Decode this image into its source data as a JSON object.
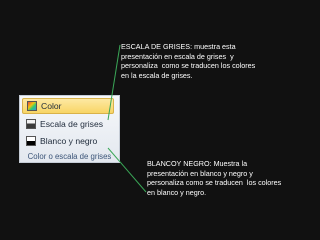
{
  "annotations": {
    "grayscale": "ESCALA DE GRISES: muestra esta\npresentación en escala de grises  y\npersonaliza  como se traducen los colores\nen la escala de grises.",
    "blackwhite": "BLANCOY NEGRO: Muestra la\npresentación en blanco y negro y\npersonaliza como se traducen  los colores\nen blanco y negro."
  },
  "ribbon": {
    "options": [
      {
        "label": "Color",
        "icon": "color-swatch-icon",
        "selected": true
      },
      {
        "label": "Escala de grises",
        "icon": "grayscale-swatch-icon",
        "selected": false
      },
      {
        "label": "Blanco y negro",
        "icon": "black-white-swatch-icon",
        "selected": false
      }
    ],
    "group_label": "Color o escala de grises"
  },
  "colors": {
    "background": "#111111",
    "text": "#ffffff",
    "connector": "#3aa757",
    "selected_fill": "#f8d566"
  }
}
